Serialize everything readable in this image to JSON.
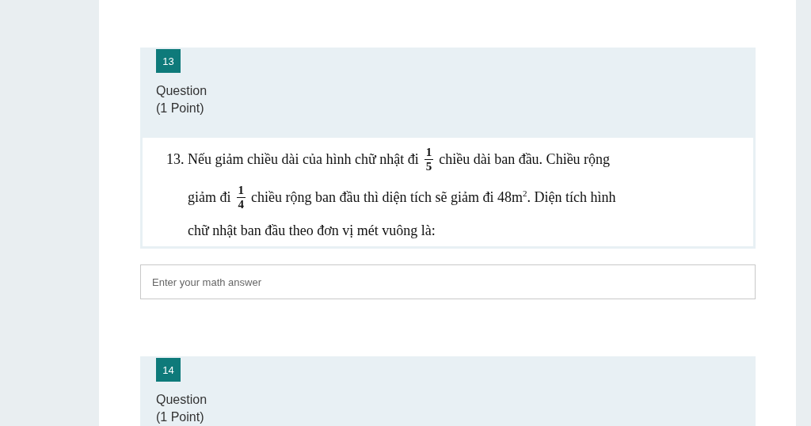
{
  "questions": [
    {
      "number": "13",
      "title": "Question",
      "points": "(1 Point)",
      "problem_lines": [
        [
          {
            "kind": "text",
            "text": "13. Nếu giảm chiều dài của hình chữ nhật đi"
          },
          {
            "kind": "fraction",
            "numerator": "1",
            "denominator": "5"
          },
          {
            "kind": "text",
            "text": "chiều dài ban đầu. Chiều rộng"
          }
        ],
        [
          {
            "kind": "text",
            "text": "giảm đi"
          },
          {
            "kind": "fraction",
            "numerator": "1",
            "denominator": "4"
          },
          {
            "kind": "text",
            "text": "chiều rộng ban đầu thì diện tích sẽ giảm đi 48m$^{2}$. Diện tích hình"
          }
        ],
        [
          {
            "kind": "text",
            "text": "chữ nhật ban đầu theo đơn vị mét vuông là:"
          }
        ]
      ],
      "answer": {
        "placeholder": "Enter your math answer"
      }
    },
    {
      "number": "14",
      "title": "Question",
      "points": "(1 Point)"
    }
  ]
}
